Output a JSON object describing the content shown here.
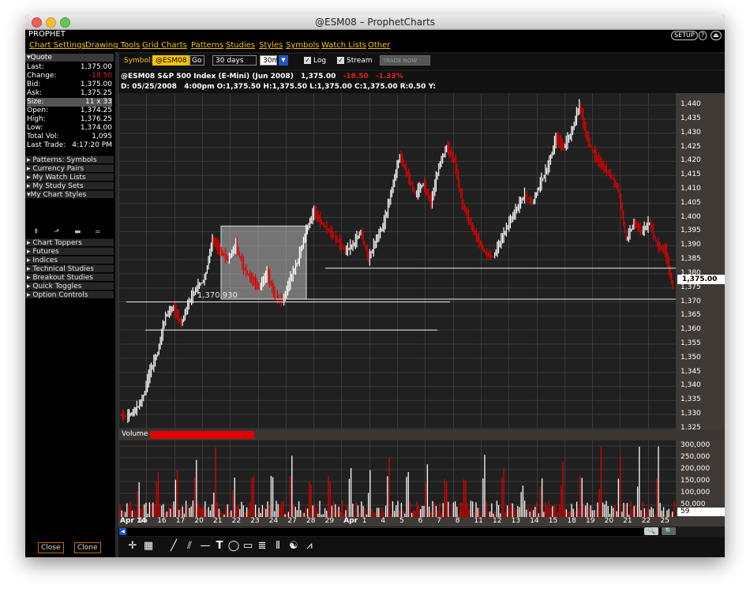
{
  "window": {
    "title": "@ESM08 – ProphetCharts"
  },
  "app": {
    "name": "PROPHET",
    "setup_label": "SETUP"
  },
  "menu": [
    "Chart Settings",
    "Drawing Tools",
    "Grid Charts",
    "Patterns",
    "Studies",
    "Styles",
    "Symbols",
    "Watch Lists",
    "Other"
  ],
  "quote": {
    "header": "▾Quote",
    "rows": [
      {
        "label": "Last:",
        "value": "1,375.00"
      },
      {
        "label": "Change:",
        "value": "-18.50"
      },
      {
        "label": "Bid:",
        "value": "1,375.00"
      },
      {
        "label": "Ask:",
        "value": "1,375.25"
      },
      {
        "label": "Size:",
        "value": "11 x 33"
      },
      {
        "label": "Open:",
        "value": "1,374.25"
      },
      {
        "label": "High:",
        "value": "1,376.25"
      },
      {
        "label": "Low:",
        "value": "1,374.00"
      },
      {
        "label": "Total Vol:",
        "value": "1,095"
      },
      {
        "label": "Last Trade:",
        "value": "4:17:20 PM"
      }
    ]
  },
  "sidebar": {
    "sections_a": [
      "▸ Patterns: Symbols",
      "▸ Currency Pairs",
      "▸ My Watch Lists",
      "▸ My Study Sets",
      "▾My Chart Styles"
    ],
    "sections_b": [
      "▸ Chart Toppers",
      "▸ Futures",
      "▸ Indices",
      "▸ Technical Studies",
      "▸ Breakout Studies",
      "▸ Quick Toggles",
      "▸ Option Controls"
    ],
    "close_label": "Close",
    "clone_label": "Clone"
  },
  "toolbar": {
    "symbol_label": "Symbol:",
    "symbol_value": "@ESM08",
    "go_label": "Go",
    "range_value": "30 days",
    "interval_value": "30m",
    "log_label": "Log",
    "stream_label": "Stream",
    "trade_label": "TRADE NOW"
  },
  "info": {
    "symbol_title": "@ESM08 S&P 500 Index (E-Mini) (Jun 2008)",
    "last": "1,375.00",
    "change": "-18.50",
    "change_pct": "-1.33%",
    "bar_line": "D: 05/25/2008   4:00pm O:1,375.50 H:1,375.50 L:1,375.00 C:1,375.00 R:0.50 Y:"
  },
  "price_tag": "1,375.00",
  "annotation_label": "1,370.930",
  "volume": {
    "label": "Volume",
    "tag": "59"
  },
  "colors": {
    "up": "#ffffff",
    "down": "#e00000",
    "accent": "#f5c400"
  },
  "chart_data": {
    "type": "line",
    "price_ticks": [
      "1,440",
      "1,435",
      "1,430",
      "1,425",
      "1,420",
      "1,415",
      "1,410",
      "1,405",
      "1,400",
      "1,395",
      "1,390",
      "1,385",
      "1,380",
      "1,375",
      "1,370",
      "1,365",
      "1,360",
      "1,355",
      "1,350",
      "1,345",
      "1,340",
      "1,335",
      "1,330",
      "1,325"
    ],
    "ylim": [
      1323,
      1442
    ],
    "volume_ticks": [
      "300,000",
      "250,000",
      "200,000",
      "150,000",
      "100,000",
      "50,000"
    ],
    "date_labels": [
      "Apr 14",
      "15",
      "16",
      "17",
      "20",
      "21",
      "22",
      "23",
      "24",
      "27",
      "28",
      "29",
      "Apr",
      "1",
      "4",
      "5",
      "6",
      "7",
      "8",
      "11",
      "12",
      "13",
      "14",
      "15",
      "18",
      "19",
      "20",
      "21",
      "22",
      "25"
    ],
    "price_path": [
      1330,
      1329,
      1331,
      1335,
      1345,
      1352,
      1365,
      1368,
      1362,
      1370,
      1375,
      1378,
      1392,
      1388,
      1385,
      1390,
      1382,
      1378,
      1375,
      1380,
      1372,
      1370,
      1378,
      1385,
      1395,
      1402,
      1398,
      1395,
      1392,
      1388,
      1390,
      1395,
      1385,
      1392,
      1398,
      1410,
      1422,
      1415,
      1408,
      1412,
      1405,
      1418,
      1425,
      1420,
      1405,
      1398,
      1392,
      1387,
      1386,
      1392,
      1398,
      1403,
      1408,
      1405,
      1412,
      1418,
      1428,
      1425,
      1430,
      1440,
      1428,
      1422,
      1418,
      1415,
      1410,
      1392,
      1398,
      1395,
      1398,
      1390,
      1388,
      1375
    ]
  }
}
